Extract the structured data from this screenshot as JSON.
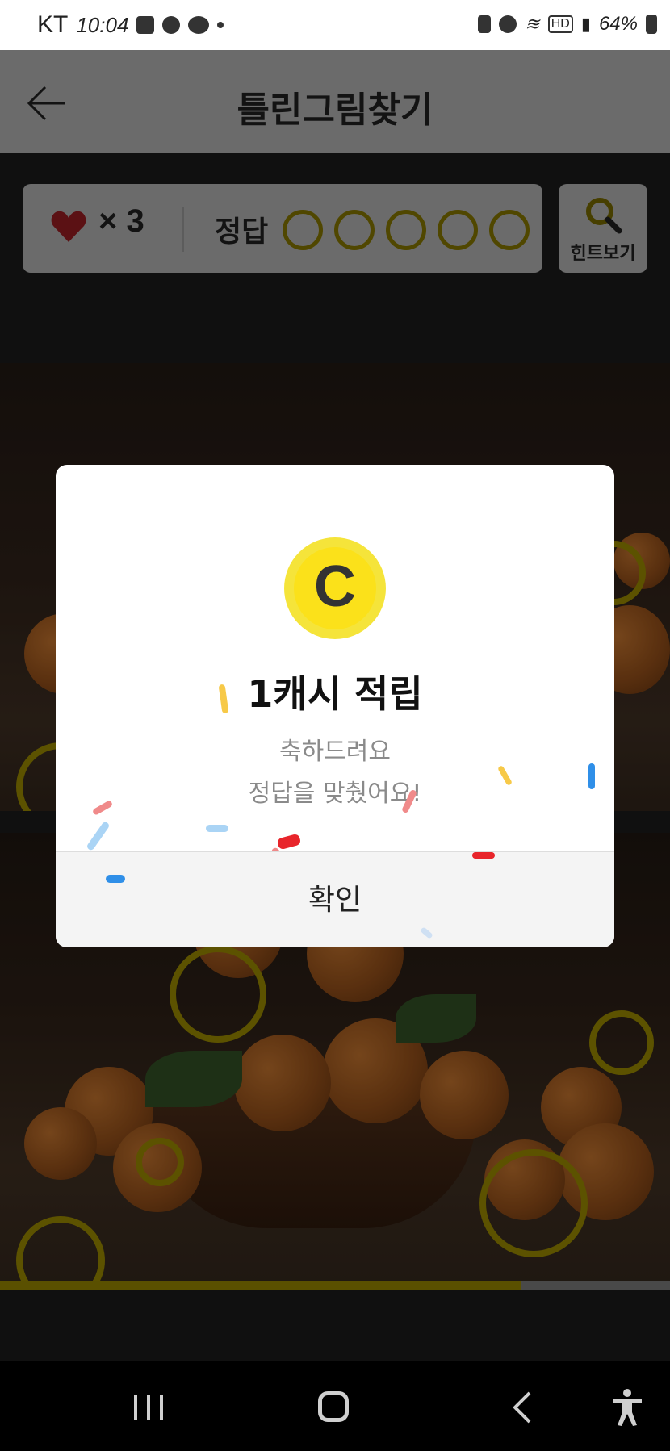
{
  "status_bar": {
    "carrier": "KT",
    "time": "10:04",
    "battery": "64%"
  },
  "app_bar": {
    "title": "틀린그림찾기"
  },
  "score": {
    "lives": "× 3",
    "answer_label": "정답",
    "found": 0,
    "total": 5
  },
  "hint": {
    "label": "힌트보기"
  },
  "dialog": {
    "title": "1캐시 적립",
    "message_line1": "축하드려요",
    "message_line2": "정답을 맞췄어요!",
    "coin_letter": "C",
    "confirm_label": "확인"
  },
  "progress": {
    "remaining_fraction": 0.777
  },
  "colors": {
    "accent": "#fbe11a",
    "ring": "#8e7f00",
    "heart": "#c0202a"
  }
}
